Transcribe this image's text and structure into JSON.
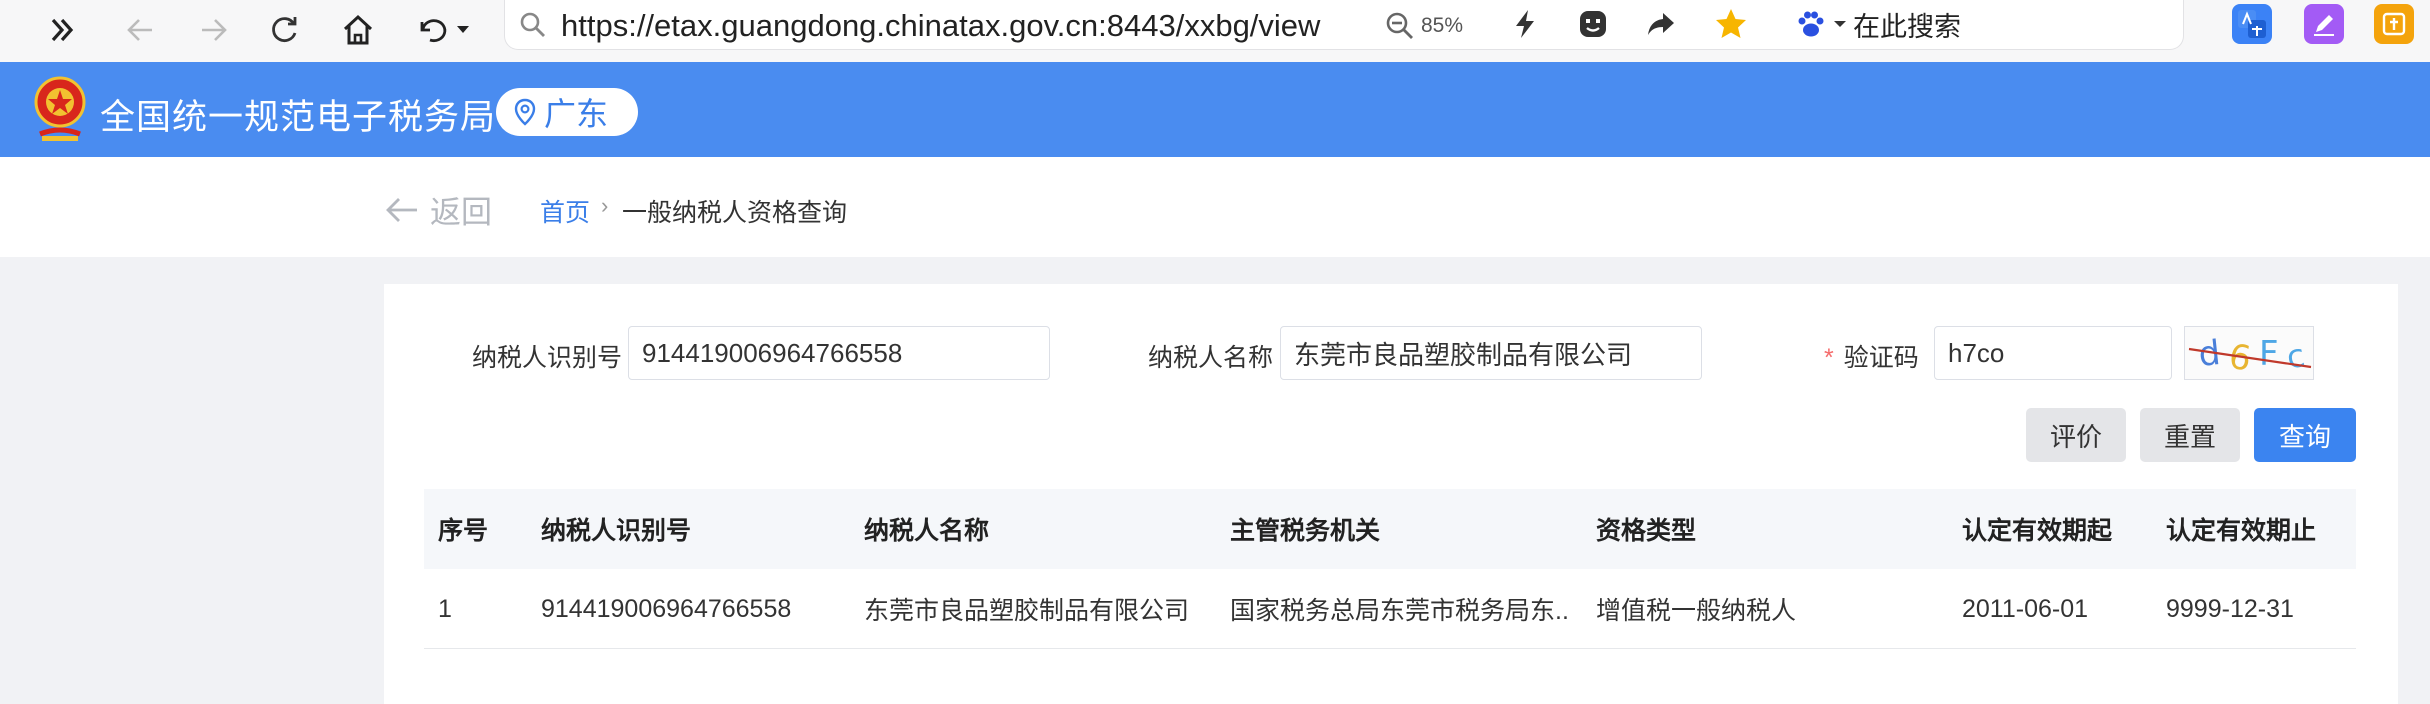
{
  "browser": {
    "url": "https://etax.guangdong.chinatax.gov.cn:8443/xxbg/view",
    "zoom": "85%",
    "search_placeholder": "在此搜索"
  },
  "header": {
    "title": "全国统一规范电子税务局",
    "region": "广东",
    "color": "#4a8cf0"
  },
  "breadcrumb": {
    "back": "返回",
    "home": "首页",
    "separator": "›",
    "current": "一般纳税人资格查询"
  },
  "form": {
    "taxpayer_id_label": "纳税人识别号",
    "taxpayer_id_value": "914419006964766558",
    "taxpayer_name_label": "纳税人名称",
    "taxpayer_name_value": "东莞市良品塑胶制品有限公司",
    "captcha_required_mark": "*",
    "captcha_label": "验证码",
    "captcha_value": "h7co",
    "captcha_image_text": "d6Fc"
  },
  "buttons": {
    "rate": "评价",
    "reset": "重置",
    "query": "查询"
  },
  "table": {
    "headers": [
      "序号",
      "纳税人识别号",
      "纳税人名称",
      "主管税务机关",
      "资格类型",
      "认定有效期起",
      "认定有效期止"
    ],
    "rows": [
      [
        "1",
        "914419006964766558",
        "东莞市良品塑胶制品有限公司",
        "国家税务总局东莞市税务局东...",
        "增值税一般纳税人",
        "2011-06-01",
        "9999-12-31"
      ]
    ]
  }
}
